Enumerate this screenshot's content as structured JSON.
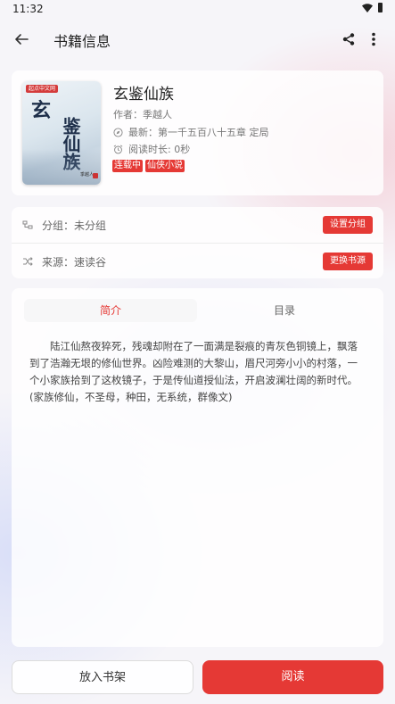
{
  "status_bar": {
    "time": "11:32"
  },
  "app_bar": {
    "title": "书籍信息"
  },
  "book": {
    "title": "玄鉴仙族",
    "author": "作者：季越人",
    "latest": "最新：第一千五百八十五章 定局",
    "reading_time": "阅读时长: 0秒",
    "tags": [
      "连载中",
      "仙侠小说"
    ],
    "cover": {
      "title_line1": "玄",
      "title_line2": "鉴仙族",
      "publisher_logo": "起点中文网",
      "author": "季越人"
    }
  },
  "info": {
    "group_label": "分组：未分组",
    "group_button": "设置分组",
    "source_label": "来源：速读谷",
    "source_button": "更换书源"
  },
  "tabs": {
    "intro": "简介",
    "toc": "目录"
  },
  "description": "陆江仙熬夜猝死，残魂却附在了一面满是裂痕的青灰色铜镜上，飘落到了浩瀚无垠的修仙世界。凶险难测的大黎山，眉尺河旁小小的村落，一个小家族拾到了这枚镜子，于是传仙道授仙法，开启波澜壮阔的新时代。(家族修仙，不圣母，种田，无系统，群像文)",
  "actions": {
    "add_shelf": "放入书架",
    "read": "阅读"
  },
  "colors": {
    "accent": "#e53935",
    "background": "#f6f5f9"
  }
}
